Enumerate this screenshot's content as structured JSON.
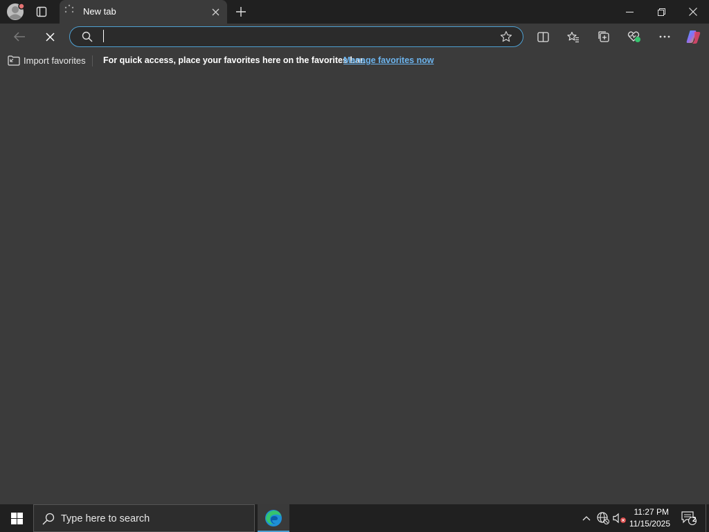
{
  "tab": {
    "title": "New tab"
  },
  "address_bar": {
    "value": ""
  },
  "favorites_bar": {
    "import_label": "Import favorites",
    "prompt": "For quick access, place your favorites here on the favorites bar.",
    "manage_link": "Manage favorites now"
  },
  "taskbar": {
    "search_placeholder": "Type here to search",
    "time": "11:27 PM",
    "date": "11/15/2025",
    "notification_count": "2"
  },
  "colors": {
    "accent": "#4ea1d3",
    "link": "#6cb4ee",
    "chrome_dark": "#202020",
    "surface": "#3b3b3b",
    "edge_blue": "#1f8fd6",
    "edge_green": "#35c46e"
  },
  "icons": {
    "profile": "profile-avatar-icon",
    "tab_actions": "tab-actions-icon",
    "loading": "loading-spinner-icon",
    "close_tab": "close-icon",
    "new_tab": "plus-icon",
    "back": "back-arrow-icon",
    "stop": "stop-icon",
    "search": "search-icon",
    "favorite": "star-icon",
    "split": "split-screen-icon",
    "favorites": "favorites-icon",
    "collections": "collections-icon",
    "health": "browser-essentials-icon",
    "menu": "more-icon",
    "copilot": "copilot-icon"
  }
}
